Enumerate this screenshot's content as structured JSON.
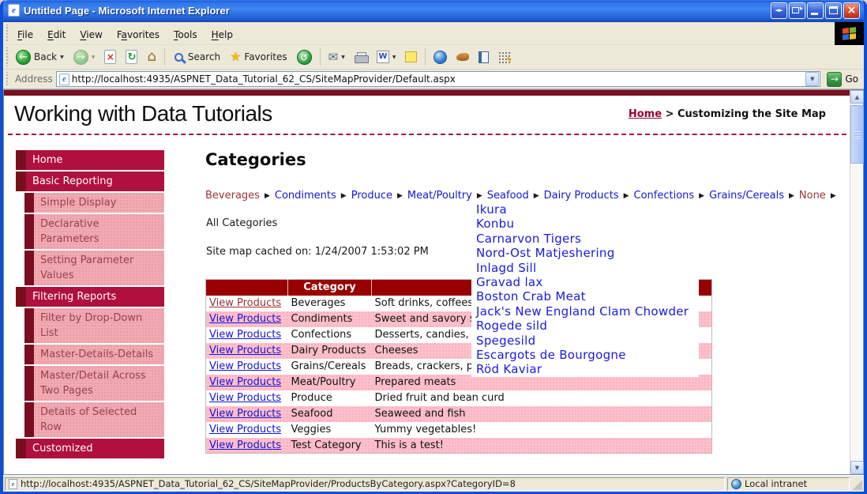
{
  "window": {
    "title": "Untitled Page - Microsoft Internet Explorer"
  },
  "menubar": {
    "items": [
      {
        "label": "File",
        "u": 0
      },
      {
        "label": "Edit",
        "u": 0
      },
      {
        "label": "View",
        "u": 0
      },
      {
        "label": "Favorites",
        "u": 1
      },
      {
        "label": "Tools",
        "u": 0
      },
      {
        "label": "Help",
        "u": 0
      }
    ]
  },
  "toolbar": {
    "back": "Back",
    "search": "Search",
    "favorites": "Favorites"
  },
  "addressbar": {
    "label": "Address",
    "url": "http://localhost:4935/ASPNET_Data_Tutorial_62_CS/SiteMapProvider/Default.aspx",
    "go": "Go"
  },
  "page": {
    "title": "Working with Data Tutorials",
    "breadcrumb": {
      "home": "Home",
      "separator": ">",
      "current": "Customizing the Site Map"
    },
    "sidebar": [
      {
        "label": "Home",
        "type": "section"
      },
      {
        "label": "Basic Reporting",
        "type": "section"
      },
      {
        "label": "Simple Display",
        "type": "sub"
      },
      {
        "label": "Declarative Parameters",
        "type": "sub"
      },
      {
        "label": "Setting Parameter Values",
        "type": "sub"
      },
      {
        "label": "Filtering Reports",
        "type": "section"
      },
      {
        "label": "Filter by Drop-Down List",
        "type": "sub"
      },
      {
        "label": "Master-Details-Details",
        "type": "sub"
      },
      {
        "label": "Master/Detail Across Two Pages",
        "type": "sub"
      },
      {
        "label": "Details of Selected Row",
        "type": "sub"
      },
      {
        "label": "Customized",
        "type": "section"
      }
    ],
    "main": {
      "heading": "Categories",
      "menu": [
        {
          "label": "Beverages",
          "visited": true
        },
        {
          "label": "Condiments",
          "visited": false
        },
        {
          "label": "Produce",
          "visited": false
        },
        {
          "label": "Meat/Poultry",
          "visited": false
        },
        {
          "label": "Seafood",
          "visited": false
        },
        {
          "label": "Dairy Products",
          "visited": false
        },
        {
          "label": "Confections",
          "visited": false
        },
        {
          "label": "Grains/Cereals",
          "visited": false
        },
        {
          "label": "None",
          "visited": true
        }
      ],
      "intro": "All Categories",
      "cache_note": "Site map cached on: 1/24/2007 1:53:02 PM",
      "table": {
        "headers": [
          "",
          "Category",
          ""
        ],
        "link_label": "View Products",
        "rows": [
          {
            "category": "Beverages",
            "description": "Soft drinks, coffees, teas, beers, and ales",
            "visited": true
          },
          {
            "category": "Condiments",
            "description": "Sweet and savory sauces, relishes, spreads, and seasonings",
            "visited": false
          },
          {
            "category": "Confections",
            "description": "Desserts, candies, and sweet breads",
            "visited": false
          },
          {
            "category": "Dairy Products",
            "description": "Cheeses",
            "visited": false
          },
          {
            "category": "Grains/Cereals",
            "description": "Breads, crackers, pasta, and cereal",
            "visited": false
          },
          {
            "category": "Meat/Poultry",
            "description": "Prepared meats",
            "visited": false
          },
          {
            "category": "Produce",
            "description": "Dried fruit and bean curd",
            "visited": false
          },
          {
            "category": "Seafood",
            "description": "Seaweed and fish",
            "visited": false
          },
          {
            "category": "Veggies",
            "description": "Yummy vegetables!",
            "visited": false
          },
          {
            "category": "Test Category",
            "description": "This is a test!",
            "visited": false
          }
        ]
      },
      "popup": [
        "Ikura",
        "Konbu",
        "Carnarvon Tigers",
        "Nord-Ost Matjeshering",
        "Inlagd Sill",
        "Gravad lax",
        "Boston Crab Meat",
        "Jack's New England Clam Chowder",
        "Rogede sild",
        "Spegesild",
        "Escargots de Bourgogne",
        "Röd Kaviar"
      ]
    }
  },
  "statusbar": {
    "url": "http://localhost:4935/ASPNET_Data_Tutorial_62_CS/SiteMapProvider/ProductsByCategory.aspx?CategoryID=8",
    "zone": "Local intranet"
  },
  "icons": {
    "window_glyph": "e",
    "scroll_arrows": "◄►",
    "pop_arrow": "▸",
    "close": "×",
    "back_arrow": "←",
    "forward_arrow": "→",
    "stop": "×",
    "refresh": "↻",
    "home": "⌂",
    "star": "★",
    "history": "↺",
    "mail": "✉",
    "caret": "▼",
    "combo_caret": "▼",
    "go_arrow": "→",
    "menu_arrow": "▶",
    "scroll_up": "▲",
    "scroll_down": "▼",
    "lightning": "ϟ",
    "word": "W"
  },
  "colors": {
    "titlebar_blue": "#2569e0",
    "frame_blue": "#0f4fd6",
    "chrome_tan": "#ece9d8",
    "accent_crimson": "#b0103e",
    "dark_maroon": "#7a0e1f",
    "sidebar_pink": "#f2aab2",
    "row_pink": "#ffc0cb",
    "table_header_red": "#990000",
    "link_blue": "#1414dc",
    "visited_maroon": "#993333",
    "breadcrumb_link": "#990033"
  }
}
